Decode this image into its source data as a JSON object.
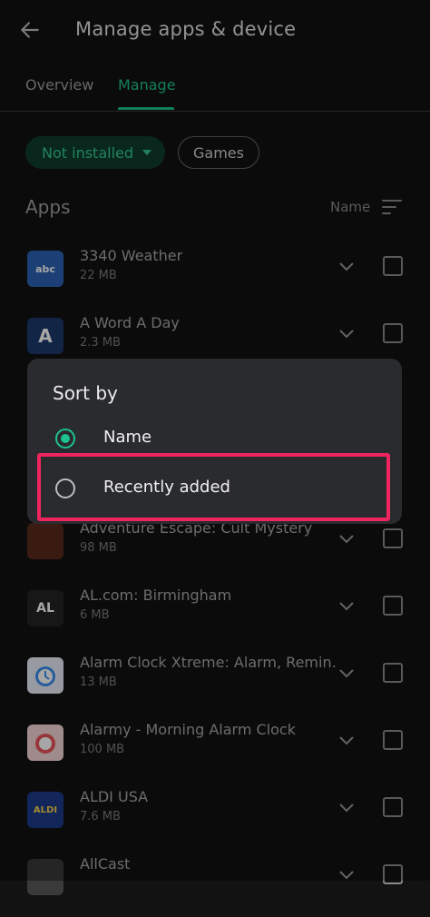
{
  "header": {
    "title": "Manage apps & device"
  },
  "tabs": [
    {
      "label": "Overview"
    },
    {
      "label": "Manage"
    }
  ],
  "filters": {
    "status_chip": "Not installed",
    "category_chip": "Games"
  },
  "section": {
    "title": "Apps",
    "sort_label": "Name"
  },
  "apps": [
    {
      "name": "3340 Weather",
      "size": "22 MB",
      "icon_text": "abc",
      "icon_color": "#2b63b6"
    },
    {
      "name": "A Word A Day",
      "size": "2.3 MB",
      "icon_text": "A",
      "icon_color": "#1e3a6e"
    },
    {
      "name": "Adventure Escape: Cult Mystery",
      "size": "98 MB",
      "icon_text": "",
      "icon_color": "#5a2a1c"
    },
    {
      "name": "AL.com: Birmingham",
      "size": "6 MB",
      "icon_text": "AL",
      "icon_color": "#242424"
    },
    {
      "name": "Alarm Clock Xtreme: Alarm, Remin…",
      "size": "13 MB",
      "icon_text": "",
      "icon_color": "#e9eef7"
    },
    {
      "name": "Alarmy - Morning Alarm Clock",
      "size": "100 MB",
      "icon_text": "",
      "icon_color": "#f5d6d6"
    },
    {
      "name": "ALDI USA",
      "size": "7.6 MB",
      "icon_text": "ALDI",
      "icon_color": "#1c3b8a"
    },
    {
      "name": "AllCast",
      "size": "",
      "icon_text": "",
      "icon_color": "#3a3a3a"
    }
  ],
  "dialog": {
    "title": "Sort by",
    "options": [
      {
        "label": "Name",
        "selected": true
      },
      {
        "label": "Recently added",
        "selected": false
      }
    ]
  },
  "colors": {
    "accent": "#1ec28b",
    "highlight": "#f0245e",
    "background": "#121212"
  }
}
